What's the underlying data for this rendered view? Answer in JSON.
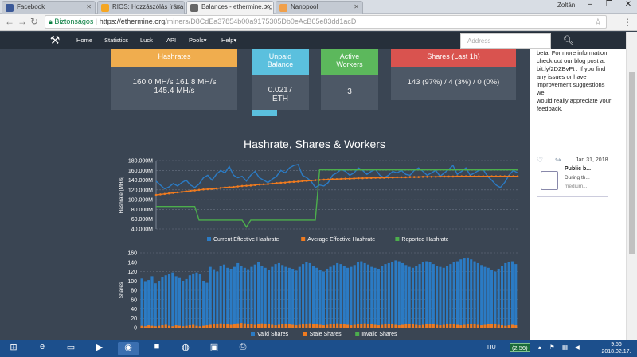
{
  "browser": {
    "tabs": [
      {
        "label": "Facebook",
        "color": "#3b5998"
      },
      {
        "label": "RIOS: Hozzászólás írása",
        "color": "#f5a623"
      },
      {
        "label": "Balances - ethermine.org",
        "color": "#666666"
      },
      {
        "label": "Nanopool",
        "color": "#f0a04b"
      }
    ],
    "user": "Zoltán",
    "address": {
      "secure_label": "Biztonságos",
      "url_host": "https://ethermine.org",
      "url_path": "/miners/D8CdEa37854b00a9175305Db0eAcB65e83dd1acD"
    }
  },
  "site_nav": {
    "items": [
      "Home",
      "Statistics",
      "Luck",
      "API",
      "Pools",
      "Help"
    ],
    "search_placeholder": "Address"
  },
  "cards": {
    "hashrates": {
      "title": "Hashrates",
      "line1": "160.0 MH/s  161.8 MH/s",
      "line2": "145.4 MH/s",
      "color": "#f0ad4e"
    },
    "unpaid": {
      "title_line1": "Unpaid",
      "title_line2": "Balance",
      "value_line1": "0.0217",
      "value_line2": "ETH",
      "color": "#5bc0de"
    },
    "workers": {
      "title_line1": "Active",
      "title_line2": "Workers",
      "value": "3",
      "color": "#5cb85c"
    },
    "shares": {
      "title": "Shares (Last 1h)",
      "value": "143 (97%) / 4 (3%) / 0 (0%)",
      "color": "#d9534f"
    }
  },
  "sidebar": {
    "text_lines": [
      "beta. For more information",
      "check out our blog post at",
      "bit.ly/2DZBvPt . If you find",
      "any issues or have",
      "improvement suggestions we",
      "would really appreciate your",
      "feedback."
    ],
    "blog_title": "Public b...",
    "blog_sub": "During th...",
    "blog_src": "medium....",
    "date": "Jan 31, 2018"
  },
  "chart_data": [
    {
      "type": "line",
      "title": "Hashrate, Shares & Workers",
      "ylabel": "Hashrate [MH/s]",
      "ylim": [
        40,
        180
      ],
      "yticks": [
        "180.000M",
        "160.000M",
        "140.000M",
        "120.000M",
        "100.000M",
        "80.000M",
        "60.000M",
        "40.000M"
      ],
      "grid": true,
      "legend_placement": "bottom",
      "series": [
        {
          "name": "Current Effective Hashrate",
          "color": "#2b7bc4",
          "values": [
            138,
            130,
            122,
            126,
            133,
            128,
            135,
            140,
            130,
            125,
            132,
            145,
            150,
            140,
            152,
            160,
            155,
            168,
            150,
            145,
            148,
            138,
            150,
            158,
            145,
            140,
            135,
            142,
            148,
            160,
            155,
            165,
            170,
            172,
            150,
            145,
            138,
            125,
            130,
            128,
            135,
            150,
            155,
            162,
            158,
            150,
            155,
            165,
            160,
            152,
            158,
            162,
            150,
            145,
            150,
            158,
            155,
            160,
            152,
            150,
            160,
            165,
            158,
            150,
            155,
            160,
            148,
            155,
            162,
            170,
            152,
            158,
            165,
            150,
            155,
            160,
            162,
            148,
            140,
            130,
            125,
            135,
            150,
            160,
            155
          ]
        },
        {
          "name": "Average Effective Hashrate",
          "color": "#f07b1f",
          "values": [
            110,
            111,
            112,
            113,
            114,
            115,
            116,
            117,
            118,
            119,
            120,
            121,
            121.5,
            122,
            123,
            124,
            125,
            125.5,
            126,
            127,
            128,
            128.5,
            129,
            130,
            131,
            131.5,
            132,
            133,
            134,
            134.5,
            135,
            136,
            136.5,
            137,
            138,
            138.5,
            139,
            140,
            140.5,
            141,
            141.5,
            142,
            142,
            142.5,
            143,
            143,
            143.5,
            144,
            144,
            144.5,
            144.5,
            145,
            145,
            145,
            145.5,
            145.5,
            146,
            146,
            146,
            146.5,
            146.5,
            146.5,
            147,
            147,
            147,
            147,
            147.5,
            147.5,
            147.5,
            147.5,
            148,
            148,
            148,
            148,
            148,
            148,
            148,
            148,
            148,
            148,
            148,
            148,
            148,
            148,
            148
          ]
        },
        {
          "name": "Reported Hashrate",
          "color": "#4cae4c",
          "values": [
            86,
            86,
            86,
            86,
            86,
            86,
            86,
            86,
            86,
            86,
            58,
            58,
            58,
            58,
            58,
            58,
            58,
            58,
            58,
            58,
            58,
            44,
            58,
            58,
            58,
            58,
            58,
            58,
            58,
            58,
            58,
            58,
            58,
            58,
            58,
            58,
            58,
            58,
            161,
            161,
            161,
            161,
            161,
            161,
            161,
            161,
            161,
            161,
            161,
            161,
            161,
            161,
            161,
            161,
            161,
            161,
            161,
            161,
            161,
            161,
            161,
            161,
            161,
            161,
            161,
            161,
            161,
            161,
            161,
            161,
            161,
            161,
            161,
            161,
            161,
            161,
            161,
            161,
            161,
            161,
            161,
            161,
            161,
            161,
            161
          ]
        }
      ]
    },
    {
      "type": "bar",
      "ylabel": "Shares",
      "ylim": [
        0,
        160
      ],
      "yticks": [
        "160",
        "140",
        "120",
        "100",
        "80",
        "60",
        "40",
        "20",
        "0"
      ],
      "grid": true,
      "legend_placement": "bottom",
      "series": [
        {
          "name": "Valid Shares",
          "color": "#2b7bc4",
          "values": [
            105,
            98,
            102,
            110,
            95,
            100,
            108,
            112,
            115,
            118,
            110,
            106,
            100,
            104,
            112,
            116,
            118,
            114,
            100,
            96,
            130,
            125,
            120,
            132,
            135,
            128,
            126,
            130,
            138,
            132,
            128,
            125,
            130,
            135,
            140,
            132,
            128,
            124,
            130,
            136,
            138,
            134,
            130,
            128,
            126,
            122,
            130,
            136,
            140,
            138,
            132,
            128,
            124,
            120,
            126,
            130,
            134,
            138,
            136,
            132,
            128,
            130,
            134,
            140,
            142,
            138,
            135,
            130,
            128,
            126,
            132,
            136,
            138,
            140,
            144,
            142,
            138,
            134,
            130,
            128,
            132,
            136,
            140,
            142,
            140,
            136,
            132,
            130,
            128,
            132,
            136,
            140,
            142,
            146,
            148,
            150,
            146,
            142,
            138,
            134,
            130,
            128,
            124,
            120,
            126,
            132,
            138,
            140,
            142,
            136
          ]
        },
        {
          "name": "Stale Shares",
          "color": "#f07b1f",
          "values": [
            4,
            3,
            5,
            4,
            3,
            4,
            5,
            6,
            4,
            3,
            5,
            4,
            3,
            4,
            5,
            6,
            4,
            3,
            4,
            5,
            6,
            7,
            8,
            9,
            8,
            7,
            6,
            8,
            9,
            10,
            9,
            8,
            7,
            6,
            8,
            9,
            8,
            7,
            6,
            5,
            6,
            7,
            8,
            7,
            6,
            5,
            6,
            7,
            8,
            9,
            8,
            7,
            6,
            5,
            6,
            7,
            8,
            9,
            8,
            7,
            6,
            5,
            6,
            7,
            8,
            9,
            8,
            7,
            6,
            5,
            6,
            7,
            8,
            7,
            6,
            5,
            6,
            7,
            8,
            7,
            6,
            5,
            6,
            7,
            8,
            7,
            6,
            5,
            6,
            7,
            8,
            7,
            6,
            5,
            6,
            7,
            8,
            7,
            6,
            5,
            6,
            7,
            8,
            7,
            6,
            5,
            4,
            5,
            6,
            5
          ]
        },
        {
          "name": "Invalid Shares",
          "color": "#4cae4c",
          "values": [
            0,
            0,
            0,
            0,
            0,
            0,
            0,
            0,
            0,
            0,
            0,
            0,
            0,
            0,
            0,
            0,
            0,
            0,
            0,
            0,
            0,
            0,
            0,
            0,
            0,
            0,
            0,
            0,
            0,
            0,
            0,
            0,
            0,
            0,
            0,
            0,
            0,
            0,
            0,
            0,
            0,
            0,
            0,
            0,
            0,
            0,
            0,
            0,
            0,
            0,
            0,
            0,
            0,
            0,
            0,
            0,
            0,
            0,
            0,
            0,
            0,
            0,
            0,
            0,
            0,
            0,
            0,
            0,
            0,
            0,
            0,
            0,
            0,
            0,
            0,
            0,
            0,
            0,
            0,
            0,
            0,
            0,
            0,
            0,
            0,
            0,
            0,
            0,
            0,
            0,
            0,
            0,
            0,
            0,
            0,
            0,
            0,
            0,
            0,
            0,
            0,
            0,
            0,
            0,
            0,
            0,
            0,
            0,
            0,
            0
          ]
        }
      ]
    }
  ],
  "taskbar": {
    "lang": "HU",
    "clock_time": "9:56",
    "clock_date": "2018.02.17.",
    "tray_badge": "(2:56)"
  }
}
